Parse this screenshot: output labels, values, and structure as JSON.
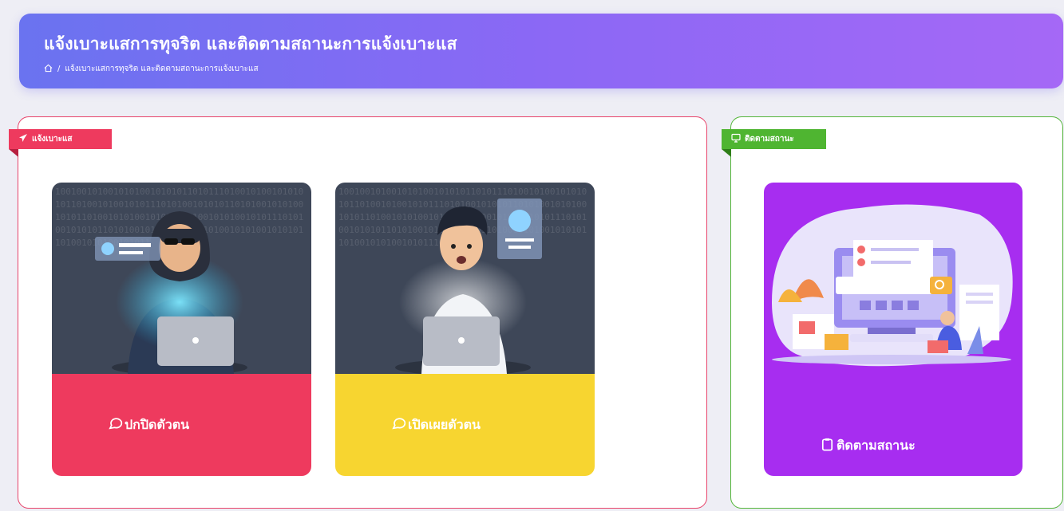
{
  "header": {
    "title": "แจ้งเบาะแสการทุจริต และติดตามสถานะการแจ้งเบาะแส",
    "breadcrumb_sep": "/",
    "breadcrumb_current": "แจ้งเบาะแสการทุจริต และติดตามสถานะการแจ้งเบาะแส"
  },
  "report_panel": {
    "ribbon_label": "แจ้งเบาะแส",
    "cards": [
      {
        "label": "ปกปิดตัวตน",
        "icon": "chat-bubble-icon"
      },
      {
        "label": "เปิดเผยตัวตน",
        "icon": "chat-bubble-icon"
      }
    ]
  },
  "track_panel": {
    "ribbon_label": "ติดตามสถานะ",
    "card": {
      "label": "ติดตามสถานะ",
      "icon": "clipboard-icon"
    }
  },
  "binary_text": "1001001010010101001010101101011101001010010101010110100101001010111010100101010110101001010100101011010010101001010101101001010100101011101010010101011010100101010010101101001010100101010110100101010010101110101001",
  "colors": {
    "header_gradient": [
      "#6a73f0",
      "#a568f6"
    ],
    "red": "#ee3a5e",
    "yellow": "#f7d530",
    "green": "#4fb531",
    "purple": "#a72df0"
  }
}
